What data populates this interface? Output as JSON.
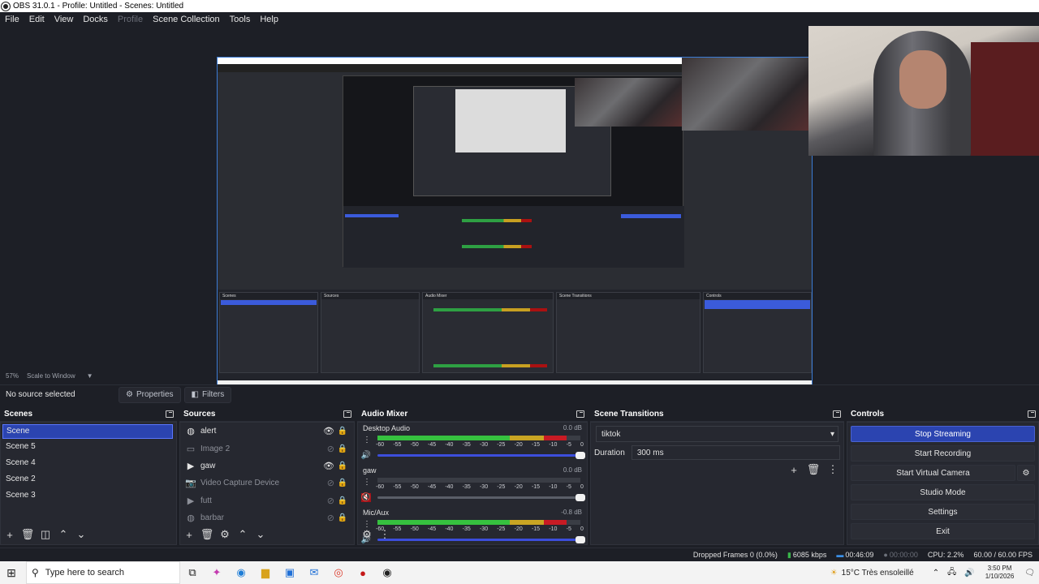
{
  "window": {
    "title": "OBS 31.0.1 - Profile: Untitled - Scenes: Untitled"
  },
  "menu": {
    "items": [
      {
        "label": "File",
        "disabled": false
      },
      {
        "label": "Edit",
        "disabled": false
      },
      {
        "label": "View",
        "disabled": false
      },
      {
        "label": "Docks",
        "disabled": false
      },
      {
        "label": "Profile",
        "disabled": true
      },
      {
        "label": "Scene Collection",
        "disabled": false
      },
      {
        "label": "Tools",
        "disabled": false
      },
      {
        "label": "Help",
        "disabled": false
      }
    ]
  },
  "preview": {
    "zoom": "57%",
    "scale_mode": "Scale to Window"
  },
  "context": {
    "no_source": "No source selected",
    "properties": "Properties",
    "filters": "Filters"
  },
  "scenes": {
    "title": "Scenes",
    "items": [
      "Scene",
      "Scene 5",
      "Scene 4",
      "Scene 2",
      "Scene 3"
    ],
    "selected": "Scene"
  },
  "sources": {
    "title": "Sources",
    "items": [
      {
        "name": "alert",
        "icon": "browser-icon",
        "visible": true,
        "locked": true
      },
      {
        "name": "Image 2",
        "icon": "image-icon",
        "visible": false,
        "locked": false
      },
      {
        "name": "gaw",
        "icon": "media-icon",
        "visible": true,
        "locked": true
      },
      {
        "name": "Video Capture Device",
        "icon": "camera-icon",
        "visible": false,
        "locked": false
      },
      {
        "name": "futt",
        "icon": "media-icon",
        "visible": false,
        "locked": true
      },
      {
        "name": "barbar",
        "icon": "browser-icon",
        "visible": false,
        "locked": true
      }
    ]
  },
  "audio_mixer": {
    "title": "Audio Mixer",
    "ticks": [
      "-60",
      "-55",
      "-50",
      "-45",
      "-40",
      "-35",
      "-30",
      "-25",
      "-20",
      "-15",
      "-10",
      "-5",
      "0"
    ],
    "channels": [
      {
        "name": "Desktop Audio",
        "db": "0.0 dB",
        "level": 0.93,
        "muted": false
      },
      {
        "name": "gaw",
        "db": "0.0 dB",
        "level": 0.0,
        "muted": true
      },
      {
        "name": "Mic/Aux",
        "db": "-0.8 dB",
        "level": 0.93,
        "muted": false
      }
    ]
  },
  "transitions": {
    "title": "Scene Transitions",
    "selected": "tiktok",
    "duration_label": "Duration",
    "duration_value": "300 ms"
  },
  "controls": {
    "title": "Controls",
    "stop_streaming": "Stop Streaming",
    "start_recording": "Start Recording",
    "start_virtual_camera": "Start Virtual Camera",
    "studio_mode": "Studio Mode",
    "settings": "Settings",
    "exit": "Exit"
  },
  "status": {
    "dropped_frames": "Dropped Frames 0 (0.0%)",
    "bitrate": "6085 kbps",
    "stream_time": "00:46:09",
    "record_time": "00:00:00",
    "cpu": "CPU: 2.2%",
    "fps": "60.00 / 60.00 FPS"
  },
  "taskbar": {
    "search_placeholder": "Type here to search",
    "weather": "15°C  Très ensoleillé",
    "time": "3:50 PM",
    "date": "1/10/2026"
  },
  "colors": {
    "accent": "#2b44b0",
    "bg": "#1d1f26",
    "panel": "#262830"
  }
}
